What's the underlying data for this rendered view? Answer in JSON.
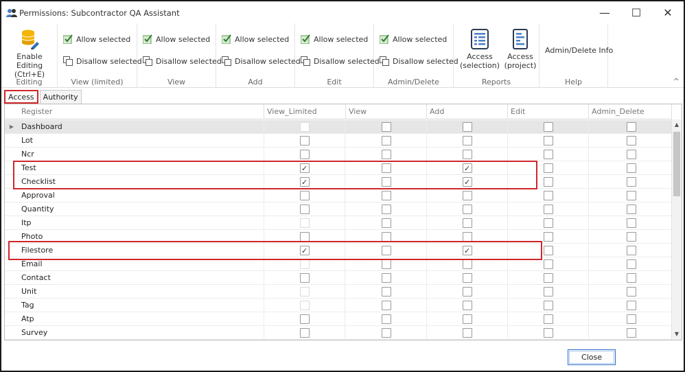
{
  "window": {
    "title": "Permissions: Subcontractor QA Assistant",
    "min_glyph": "—",
    "max_glyph": "☐",
    "close_glyph": "✕"
  },
  "ribbon": {
    "editing": {
      "button": "Enable Editing\n(Ctrl+E)",
      "label": "Editing"
    },
    "perm_groups": [
      {
        "label": "View (limited)",
        "allow": "Allow selected",
        "disallow": "Disallow selected"
      },
      {
        "label": "View",
        "allow": "Allow selected",
        "disallow": "Disallow selected"
      },
      {
        "label": "Add",
        "allow": "Allow selected",
        "disallow": "Disallow selected"
      },
      {
        "label": "Edit",
        "allow": "Allow selected",
        "disallow": "Disallow selected"
      },
      {
        "label": "Admin/Delete",
        "allow": "Allow selected",
        "disallow": "Disallow selected"
      }
    ],
    "reports": {
      "label": "Reports",
      "access_selection": "Access\n(selection)",
      "access_project": "Access\n(project)"
    },
    "help": {
      "label": "Help",
      "admin_delete_info": "Admin/Delete Info"
    },
    "collapse_glyph": "^"
  },
  "tabs": [
    {
      "label": "Access",
      "active": true
    },
    {
      "label": "Authority",
      "active": false
    }
  ],
  "grid": {
    "columns": [
      "Register",
      "View_Limited",
      "View",
      "Add",
      "Edit",
      "Admin_Delete"
    ],
    "row_indicator_glyph": "▶",
    "rows": [
      {
        "name": "Dashboard",
        "selected": true,
        "vl": false,
        "v": false,
        "a": false,
        "e": false,
        "ad": false,
        "vl_disabled": true
      },
      {
        "name": "Lot",
        "vl": false,
        "v": false,
        "a": false,
        "e": false,
        "ad": false
      },
      {
        "name": "Ncr",
        "vl": false,
        "v": false,
        "a": false,
        "e": false,
        "ad": false
      },
      {
        "name": "Test",
        "vl": true,
        "v": false,
        "a": true,
        "e": false,
        "ad": false
      },
      {
        "name": "Checklist",
        "vl": true,
        "v": false,
        "a": true,
        "e": false,
        "ad": false
      },
      {
        "name": "Approval",
        "vl": false,
        "v": false,
        "a": false,
        "e": false,
        "ad": false
      },
      {
        "name": "Quantity",
        "vl": false,
        "v": false,
        "a": false,
        "e": false,
        "ad": false
      },
      {
        "name": "Itp",
        "vl": false,
        "v": false,
        "a": false,
        "e": false,
        "ad": false,
        "vl_disabled": true
      },
      {
        "name": "Photo",
        "vl": false,
        "v": false,
        "a": false,
        "e": false,
        "ad": false
      },
      {
        "name": "Filestore",
        "vl": true,
        "v": false,
        "a": true,
        "e": false,
        "ad": false
      },
      {
        "name": "Email",
        "vl": false,
        "v": false,
        "a": false,
        "e": false,
        "ad": false,
        "vl_disabled": true
      },
      {
        "name": "Contact",
        "vl": false,
        "v": false,
        "a": false,
        "e": false,
        "ad": false
      },
      {
        "name": "Unit",
        "vl": false,
        "v": false,
        "a": false,
        "e": false,
        "ad": false,
        "vl_disabled": true
      },
      {
        "name": "Tag",
        "vl": false,
        "v": false,
        "a": false,
        "e": false,
        "ad": false,
        "vl_disabled": true
      },
      {
        "name": "Atp",
        "vl": false,
        "v": false,
        "a": false,
        "e": false,
        "ad": false
      },
      {
        "name": "Survey",
        "vl": false,
        "v": false,
        "a": false,
        "e": false,
        "ad": false
      }
    ],
    "tick_glyph": "✓",
    "scroll_up_glyph": "▲",
    "scroll_down_glyph": "▼"
  },
  "footer": {
    "close_label": "Close"
  },
  "colors": {
    "highlight": "#d0262a",
    "accent": "#2a6fc9",
    "allow_icon_green": "#4caf50"
  }
}
